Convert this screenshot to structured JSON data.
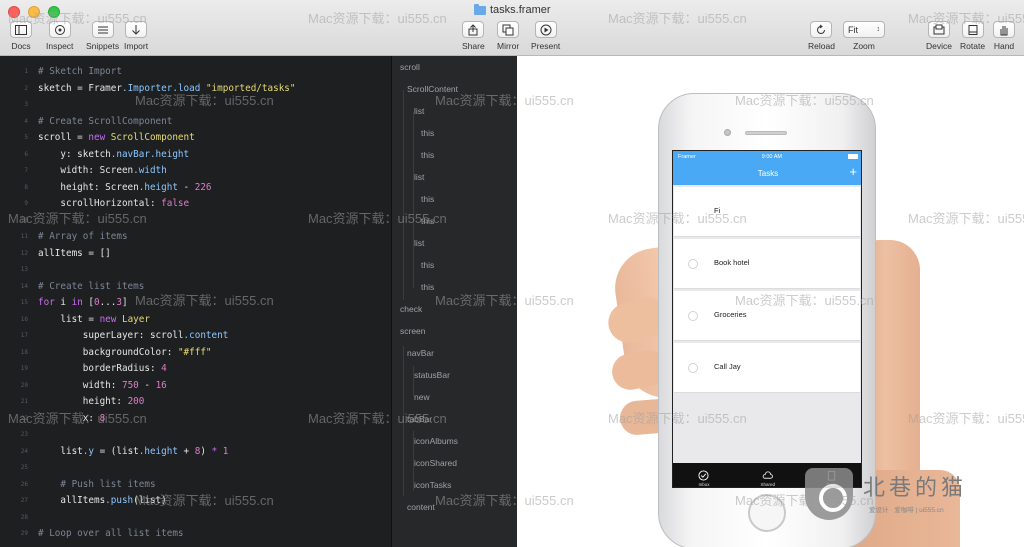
{
  "window": {
    "title": "tasks.framer"
  },
  "toolbar": {
    "left": [
      {
        "label": "Docs",
        "icon": "sidebar-icon"
      },
      {
        "label": "Inspect",
        "icon": "target-icon"
      },
      {
        "label": "Snippets",
        "icon": "list-icon"
      },
      {
        "label": "Import",
        "icon": "download-icon"
      }
    ],
    "center": [
      {
        "label": "Share",
        "icon": "share-icon"
      },
      {
        "label": "Mirror",
        "icon": "mirror-icon"
      },
      {
        "label": "Present",
        "icon": "play-icon"
      }
    ],
    "reload_label": "Reload",
    "zoom_label": "Zoom",
    "zoom_value": "Fit",
    "right": [
      {
        "label": "Device",
        "icon": "device-icon"
      },
      {
        "label": "Rotate",
        "icon": "rotate-icon"
      },
      {
        "label": "Hand",
        "icon": "hand-icon"
      }
    ]
  },
  "code": [
    {
      "n": "1",
      "t": [
        [
          "cm",
          "# Sketch Import"
        ]
      ]
    },
    {
      "n": "2",
      "t": [
        [
          "",
          "sketch = Framer"
        ],
        [
          "prop",
          ".Importer.load "
        ],
        [
          "str",
          "\"imported/tasks\""
        ]
      ]
    },
    {
      "n": "3",
      "t": []
    },
    {
      "n": "4",
      "t": [
        [
          "cm",
          "# Create ScrollComponent"
        ]
      ]
    },
    {
      "n": "5",
      "t": [
        [
          "",
          "scroll = "
        ],
        [
          "kw",
          "new "
        ],
        [
          "str",
          "ScrollComponent"
        ]
      ]
    },
    {
      "n": "6",
      "t": [
        [
          "",
          "    y: sketch"
        ],
        [
          "prop",
          ".navBar.height"
        ]
      ]
    },
    {
      "n": "7",
      "t": [
        [
          "",
          "    width: Screen"
        ],
        [
          "prop",
          ".width"
        ]
      ]
    },
    {
      "n": "8",
      "t": [
        [
          "",
          "    height: Screen"
        ],
        [
          "prop",
          ".height"
        ],
        [
          "",
          " - "
        ],
        [
          "num",
          "226"
        ]
      ]
    },
    {
      "n": "9",
      "t": [
        [
          "",
          "    scrollHorizontal: "
        ],
        [
          "num",
          "false"
        ]
      ]
    },
    {
      "n": "10",
      "t": []
    },
    {
      "n": "11",
      "t": [
        [
          "cm",
          "# Array of items"
        ]
      ]
    },
    {
      "n": "12",
      "t": [
        [
          "",
          "allItems = []"
        ]
      ]
    },
    {
      "n": "13",
      "t": []
    },
    {
      "n": "14",
      "t": [
        [
          "cm",
          "# Create list items"
        ]
      ]
    },
    {
      "n": "15",
      "t": [
        [
          "kw",
          "for "
        ],
        [
          "",
          "i "
        ],
        [
          "kw",
          "in "
        ],
        [
          "",
          "["
        ],
        [
          "num",
          "0"
        ],
        [
          "",
          "..."
        ],
        [
          "num",
          "3"
        ],
        [
          "",
          "]"
        ]
      ]
    },
    {
      "n": "16",
      "t": [
        [
          "",
          "    list = "
        ],
        [
          "kw",
          "new "
        ],
        [
          "str",
          "Layer"
        ]
      ]
    },
    {
      "n": "17",
      "t": [
        [
          "",
          "        superLayer: scroll"
        ],
        [
          "prop",
          ".content"
        ]
      ]
    },
    {
      "n": "18",
      "t": [
        [
          "",
          "        backgroundColor: "
        ],
        [
          "str",
          "\"#fff\""
        ]
      ]
    },
    {
      "n": "19",
      "t": [
        [
          "",
          "        borderRadius: "
        ],
        [
          "num",
          "4"
        ]
      ]
    },
    {
      "n": "20",
      "t": [
        [
          "",
          "        width: "
        ],
        [
          "num",
          "750"
        ],
        [
          "",
          " - "
        ],
        [
          "num",
          "16"
        ]
      ]
    },
    {
      "n": "21",
      "t": [
        [
          "",
          "        height: "
        ],
        [
          "num",
          "200"
        ]
      ]
    },
    {
      "n": "22",
      "t": [
        [
          "",
          "        x: "
        ],
        [
          "num",
          "8"
        ]
      ]
    },
    {
      "n": "23",
      "t": []
    },
    {
      "n": "24",
      "t": [
        [
          "",
          "    list"
        ],
        [
          "prop",
          ".y"
        ],
        [
          "",
          " = (list"
        ],
        [
          "prop",
          ".height"
        ],
        [
          "",
          " + "
        ],
        [
          "num",
          "8"
        ],
        [
          "",
          ") "
        ],
        [
          "kw",
          "*"
        ],
        [
          "",
          " "
        ],
        [
          "num",
          "1"
        ]
      ]
    },
    {
      "n": "25",
      "t": []
    },
    {
      "n": "26",
      "t": [
        [
          "cm",
          "    # Push list items"
        ]
      ]
    },
    {
      "n": "27",
      "t": [
        [
          "",
          "    allItems"
        ],
        [
          "prop",
          ".push"
        ],
        [
          "",
          "(list)"
        ]
      ]
    },
    {
      "n": "28",
      "t": []
    },
    {
      "n": "29",
      "t": [
        [
          "cm",
          "# Loop over all list items"
        ]
      ]
    }
  ],
  "layers": [
    "scroll",
    "ScrollContent",
    "list",
    "this",
    "this",
    "list",
    "this",
    "this",
    "list",
    "this",
    "this",
    "check",
    "screen",
    "navBar",
    "statusBar",
    "new",
    "tabBar",
    "iconAlbums",
    "iconShared",
    "iconTasks",
    "content"
  ],
  "app": {
    "status_carrier": "Framer",
    "status_time": "9:00 AM",
    "nav_title": "Tasks",
    "nav_add": "+",
    "tasks": [
      "Fi",
      "Book hotel",
      "Groceries",
      "Call Jay"
    ],
    "tabs": [
      "Inbox",
      "Shared",
      "Tasks"
    ]
  },
  "watermark": "Mac资源下载：ui555.cn",
  "brand": {
    "name": "北巷的猫",
    "sub": "爱设计 · 爱咖啡 | ui555.cn"
  }
}
